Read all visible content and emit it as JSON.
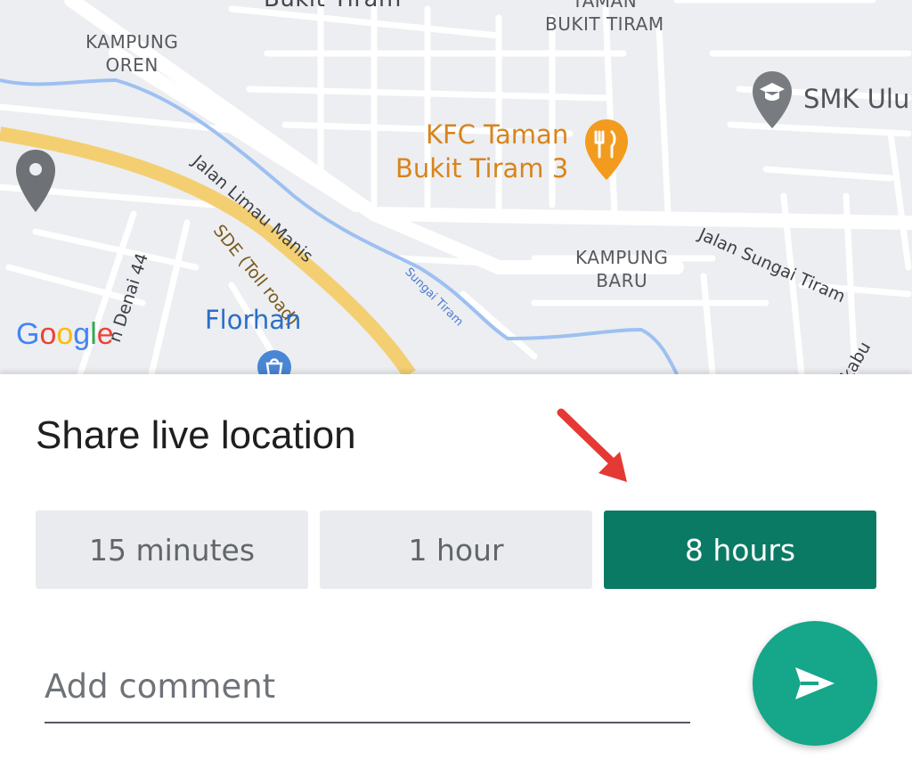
{
  "map": {
    "labels": {
      "kampung_oren": "KAMPUNG\nOREN",
      "taman_bukit_tiram": "TAMAN\nBUKIT TIRAM",
      "bukit_tiram_top": "Bukit Tiram",
      "kfc": "KFC Taman\nBukit Tiram 3",
      "smk": "SMK Ulu",
      "jalan_limau_manis": "Jalan Limau Manis",
      "sde_toll": "SDE (Toll road)",
      "denai": "n Denai 44",
      "sungai_tiram_river": "Sungai Tiram",
      "jalan_sungai_tiram": "Jalan Sungai Tiram",
      "kampung_baru": "KAMPUNG\nBARU",
      "florhan": "Florhan",
      "kabu": "kabu"
    },
    "branding": {
      "google": [
        "G",
        "o",
        "o",
        "g",
        "l",
        "e"
      ]
    },
    "icons": [
      "location-pin-icon",
      "school-pin-icon",
      "restaurant-pin-icon",
      "shopping-bag-icon"
    ]
  },
  "sheet": {
    "title": "Share live location",
    "durations": [
      {
        "label": "15 minutes",
        "selected": false
      },
      {
        "label": "1 hour",
        "selected": false
      },
      {
        "label": "8 hours",
        "selected": true
      }
    ],
    "comment_placeholder": "Add comment",
    "send_icon": "send-arrow-icon",
    "annotation_icon": "red-pointer-arrow-icon"
  },
  "colors": {
    "accent_selected": "#0b7a64",
    "send_button": "#16a68a",
    "annotation": "#e53935"
  }
}
